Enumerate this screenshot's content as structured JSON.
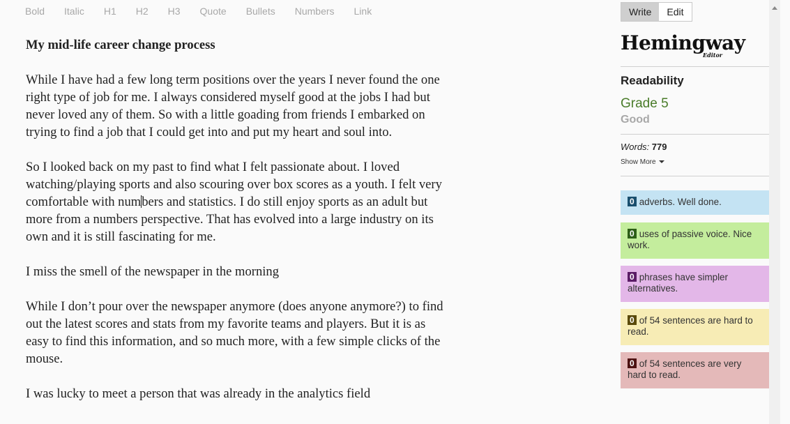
{
  "toolbar": {
    "bold": "Bold",
    "italic": "Italic",
    "h1": "H1",
    "h2": "H2",
    "h3": "H3",
    "quote": "Quote",
    "bullets": "Bullets",
    "numbers": "Numbers",
    "link": "Link"
  },
  "document": {
    "title": "My mid-life career change process",
    "p1": "While I have had a few long term positions over the years I never found the one right type of job for me. I always considered myself good at the jobs I had but never loved any of them. So with a little goading from friends I embarked on trying to find a job that I could get into and put my heart and soul into.",
    "p2_before_caret": "So I looked back on my past to find what I felt passionate about. I loved watching/playing sports and also scouring over box scores as a youth. I felt very comfortable with num",
    "p2_after_caret": "bers and statistics. I do still enjoy sports as an adult but more from a numbers perspective. That has evolved into a large industry on its own and it is still fascinating for me.",
    "p3": "I miss the smell of the newspaper in the morning",
    "p4": "While I don’t pour over the newspaper anymore (does anyone anymore?) to find out the latest scores and stats from my favorite teams and players. But it is as easy to find this information, and so much more, with a few simple clicks of the mouse.",
    "p5": "I was lucky to meet a person that was already in the analytics field"
  },
  "sidebar": {
    "mode_write": "Write",
    "mode_edit": "Edit",
    "logo_main": "Hemingway",
    "logo_sub": "Editor",
    "readability_label": "Readability",
    "grade": "Grade 5",
    "grade_desc": "Good",
    "words_label": "Words:",
    "words_count": "779",
    "show_more": "Show More",
    "cards": {
      "adverbs": {
        "count": "0",
        "text": "adverbs. Well done.",
        "color": "#c4e3f3"
      },
      "passive": {
        "count": "0",
        "text": "uses of passive voice. Nice work.",
        "color": "#c4ed9d"
      },
      "phrases": {
        "count": "0",
        "text": "phrases have simpler alternatives.",
        "color": "#e3b7e8"
      },
      "hard": {
        "count": "0",
        "text": "of 54 sentences are hard to read.",
        "color": "#f7ecb5"
      },
      "veryhard": {
        "count": "0",
        "text": "of 54 sentences are very hard to read.",
        "color": "#e4b9b9"
      }
    }
  }
}
